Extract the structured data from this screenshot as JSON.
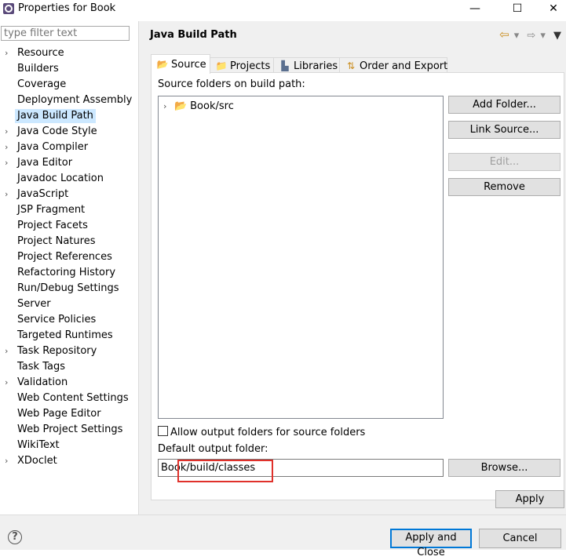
{
  "window": {
    "title": "Properties for Book",
    "minimize": "—",
    "maximize": "☐",
    "close": "✕"
  },
  "filter": {
    "placeholder": "type filter text"
  },
  "nav": [
    {
      "label": "Resource",
      "expandable": true
    },
    {
      "label": "Builders",
      "expandable": false
    },
    {
      "label": "Coverage",
      "expandable": false
    },
    {
      "label": "Deployment Assembly",
      "expandable": false
    },
    {
      "label": "Java Build Path",
      "expandable": false,
      "selected": true
    },
    {
      "label": "Java Code Style",
      "expandable": true
    },
    {
      "label": "Java Compiler",
      "expandable": true
    },
    {
      "label": "Java Editor",
      "expandable": true
    },
    {
      "label": "Javadoc Location",
      "expandable": false
    },
    {
      "label": "JavaScript",
      "expandable": true
    },
    {
      "label": "JSP Fragment",
      "expandable": false
    },
    {
      "label": "Project Facets",
      "expandable": false
    },
    {
      "label": "Project Natures",
      "expandable": false
    },
    {
      "label": "Project References",
      "expandable": false
    },
    {
      "label": "Refactoring History",
      "expandable": false
    },
    {
      "label": "Run/Debug Settings",
      "expandable": false
    },
    {
      "label": "Server",
      "expandable": false
    },
    {
      "label": "Service Policies",
      "expandable": false
    },
    {
      "label": "Targeted Runtimes",
      "expandable": false
    },
    {
      "label": "Task Repository",
      "expandable": true
    },
    {
      "label": "Task Tags",
      "expandable": false
    },
    {
      "label": "Validation",
      "expandable": true
    },
    {
      "label": "Web Content Settings",
      "expandable": false
    },
    {
      "label": "Web Page Editor",
      "expandable": false
    },
    {
      "label": "Web Project Settings",
      "expandable": false
    },
    {
      "label": "WikiText",
      "expandable": false
    },
    {
      "label": "XDoclet",
      "expandable": true
    }
  ],
  "page": {
    "title": "Java Build Path",
    "tabs": [
      {
        "label": "Source",
        "icon": "source-folder-icon",
        "active": true
      },
      {
        "label": "Projects",
        "icon": "projects-icon"
      },
      {
        "label": "Libraries",
        "icon": "libraries-icon"
      },
      {
        "label": "Order and Export",
        "icon": "order-export-icon"
      }
    ],
    "source_folders_label": "Source folders on build path:",
    "source_folders": [
      "Book/src"
    ],
    "buttons": {
      "add_folder": "Add Folder...",
      "link_source": "Link Source...",
      "edit": "Edit...",
      "remove": "Remove",
      "browse": "Browse...",
      "apply": "Apply"
    },
    "allow_output_label": "Allow output folders for source folders",
    "allow_output_checked": false,
    "default_output_label": "Default output folder:",
    "default_output_value": "Book/build/classes"
  },
  "footer": {
    "help": "?",
    "apply_close": "Apply and Close",
    "cancel": "Cancel"
  },
  "colors": {
    "selection": "#cce8ff",
    "default_button_border": "#0078d7",
    "highlight_box": "#e0312b"
  }
}
